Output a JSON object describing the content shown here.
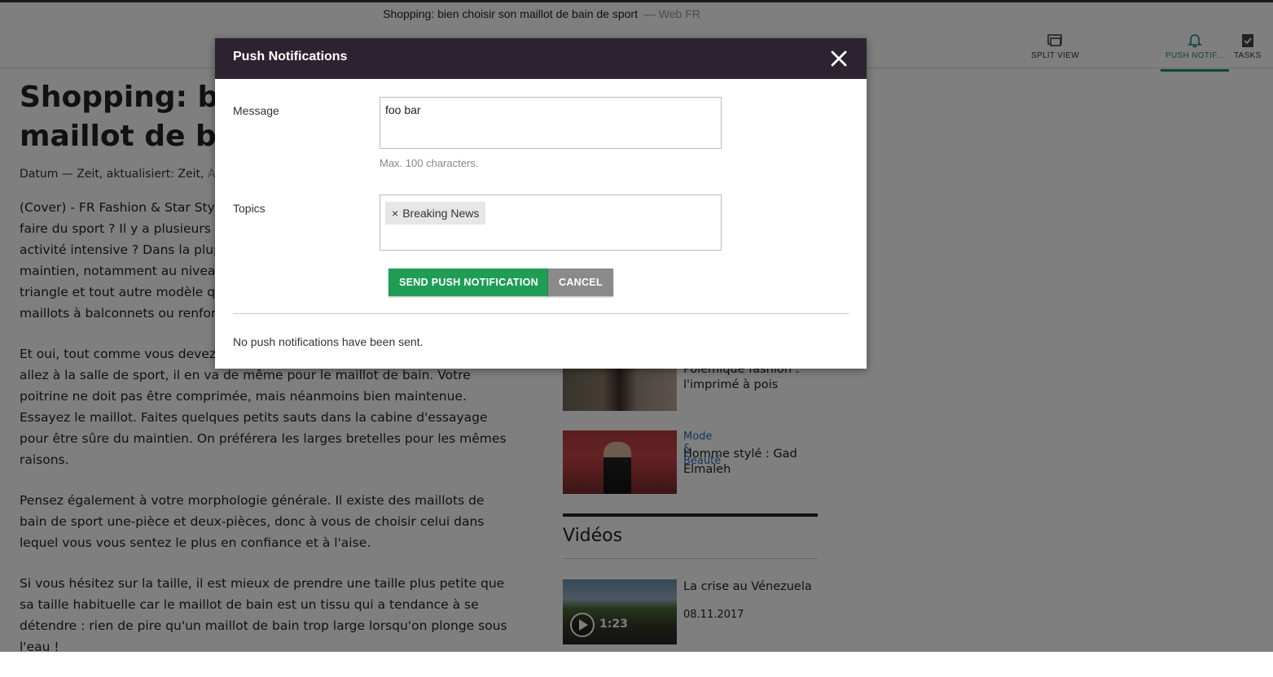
{
  "topbar": {
    "doc_title": "Shopping: bien choisir son maillot de bain de sport",
    "doc_suffix": "— Web FR",
    "split_view": "SPLIT VIEW",
    "push_notif": "PUSH NOTIF...",
    "tasks": "TASKS",
    "icons": [
      "split-view-icon",
      "bell-icon",
      "tasks-icon"
    ],
    "accent_color": "#1a8a7a"
  },
  "article": {
    "headline": "Shopping: bien choisir son maillot de bain de sport",
    "meta_text": "Datum — Zeit, aktualisiert: Zeit,",
    "meta_grey": "Au",
    "paragraphs": [
      "(Cover) - FR Fashion & Star Style : comment choisir son maillot de bain pour faire du sport ? Il y a plusieurs critères à prendre en compte pour faire une activité intensive ? Dans la plupart des cas, il faut privilégier un bon maintien, notamment au niveau de la poitrine. On oublie donc le bikini triangle et tout autre modèle qui ne tient pas bien et on opte pour les maillots à balconnets ou renforcés.",
      "Et oui, tout comme vous devez choisir une brassière adaptée quand vous allez à la salle de sport, il en va de même pour le maillot de bain. Votre poitrine ne doit pas être comprimée, mais néanmoins bien maintenue. Essayez le maillot. Faites quelques petits sauts dans la cabine d'essayage pour être sûre du maintien. On préférera les larges bretelles pour les mêmes raisons.",
      "Pensez également à votre morphologie générale. Il existe des maillots de bain de sport une-pièce et deux-pièces, donc à vous de choisir celui dans lequel vous vous sentez le plus en confiance et à l'aise.",
      "Si vous hésitez sur la taille, il est mieux de prendre une taille plus petite que sa taille habituelle car le maillot de bain est un tissu qui a tendance à se détendre : rien de pire qu'un maillot de bain trop large lorsqu'on plonge sous l'eau !"
    ]
  },
  "sidebar": {
    "items": [
      {
        "category": "",
        "title": "Polémique fashion : l'imprimé à pois"
      },
      {
        "category": "Mode & Beauté",
        "title": "Homme stylé : Gad Elmaleh"
      }
    ],
    "videos_heading": "Vidéos",
    "video": {
      "title": "La crise au Vénezuela",
      "date": "08.11.2017",
      "duration": "1:23"
    }
  },
  "modal": {
    "title": "Push Notifications",
    "message_label": "Message",
    "message_value": "foo bar",
    "message_hint": "Max. 100 characters.",
    "topics_label": "Topics",
    "topics": [
      "Breaking News"
    ],
    "send_label": "SEND PUSH NOTIFICATION",
    "cancel_label": "CANCEL",
    "status": "No push notifications have been sent.",
    "header_color": "#2d2330",
    "send_color": "#1f9d55",
    "cancel_color": "#8a8a8a"
  }
}
